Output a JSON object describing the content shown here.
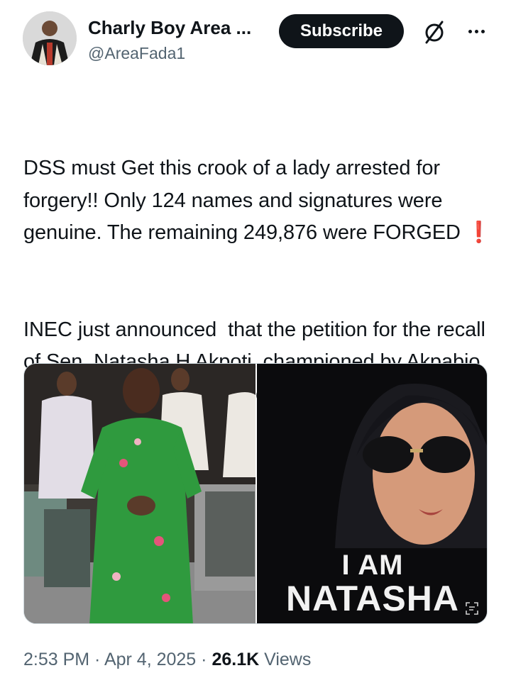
{
  "author": {
    "display_name": "Charly Boy Area ...",
    "handle": "@AreaFada1"
  },
  "actions": {
    "subscribe_label": "Subscribe",
    "grok_icon": "grok-icon",
    "more_icon": "more-options-icon"
  },
  "tweet": {
    "line1": "DSS must Get this crook of a lady arrested for forgery!! Only 124 names and signatures were genuine. The remaining 249,876 were FORGED ",
    "exclamation": "❗",
    "line2": "INEC just announced  that the petition for the recall of Sen. Natasha H Akpoti, championed by Akpabio and Yahaya Bello, na Fake."
  },
  "media": {
    "poster_line1": "I AM",
    "poster_line2": "NATASHA"
  },
  "meta": {
    "time": "2:53 PM",
    "sep1": " · ",
    "date": "Apr 4, 2025",
    "sep2": " · ",
    "views_count": "26.1K",
    "views_label": " Views"
  },
  "colors": {
    "primary_text": "#0f1419",
    "secondary_text": "#536471",
    "subscribe_bg": "#0f1419",
    "dress_green": "#2f9a3e"
  }
}
